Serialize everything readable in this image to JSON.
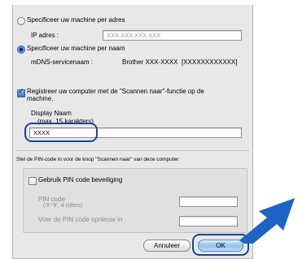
{
  "address": {
    "radio_label": "Specificeer uw machine per adres",
    "ip_label": "IP adres :",
    "ip_placeholder": "XXX.XXX.XXX.XXX"
  },
  "name": {
    "radio_label": "Specificeer uw machine per naam",
    "mdns_label": "mDNS-servicenaam :",
    "mdns_value": "Brother XXX-XXXX",
    "mdns_bracket": "[XXXXXXXXXXXX]"
  },
  "register": {
    "checkbox_label_line1": "Registreer uw computer met de \"Scannen naar\"-functie op de",
    "checkbox_label_line2": "machine.",
    "display_name_label": "Display Naam",
    "display_name_hint": "(max. 15 karakters)",
    "display_name_value": "XXXX"
  },
  "pin": {
    "section_label": "Stel de PIN-code in voor de knop \"Scannen naar\" van deze computer",
    "checkbox_label": "Gebruik PIN code beveiliging",
    "pin_label": "PIN code",
    "pin_hint": "('0'-'9', 4 cijfers)",
    "pin_repeat_label": "Voer de PIN code opnieuw in"
  },
  "buttons": {
    "cancel": "Annuleer",
    "ok": "OK"
  },
  "colors": {
    "highlight": "#16479b",
    "arrow": "#1d63c2"
  }
}
